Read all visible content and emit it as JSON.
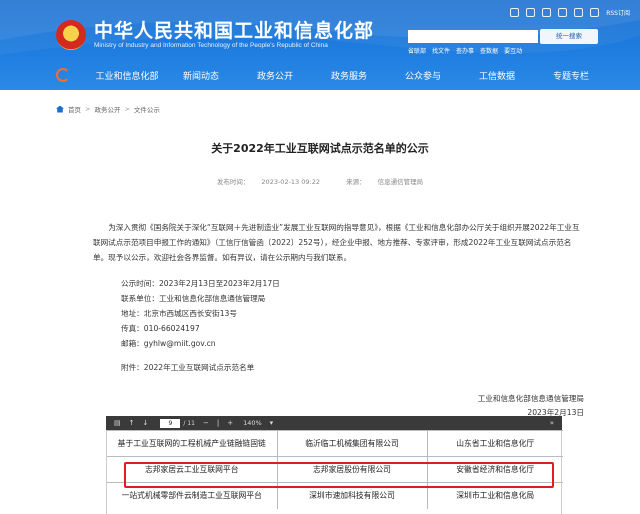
{
  "header": {
    "title": "中华人民共和国工业和信息化部",
    "subtitle": "Ministry of Industry and Information Technology of the People's Republic of China",
    "rss_label": "RSS订阅",
    "search_button": "统一搜索",
    "quick_links": [
      "省联部",
      "找文件",
      "查办事",
      "查数据",
      "要互动"
    ]
  },
  "nav": {
    "items": [
      "工业和信息化部",
      "新闻动态",
      "政务公开",
      "政务服务",
      "公众参与",
      "工信数据",
      "专题专栏"
    ]
  },
  "breadcrumb": [
    "首页",
    "政务公开",
    "文件公示"
  ],
  "article": {
    "title": "关于2022年工业互联网试点示范名单的公示",
    "publish_label": "发布时间：",
    "publish_time": "2023-02-13 09:22",
    "source_label": "来源：",
    "source": "信息通信管理局",
    "paragraph": "为深入贯彻《国务院关于深化“互联网＋先进制造业”发展工业互联网的指导意见》，根据《工业和信息化部办公厅关于组织开展2022年工业互联网试点示范项目申报工作的通知》（工信厅信管函〔2022〕252号），经企业申报、地方推荐、专家评审，形成2022年工业互联网试点示范名单。现予以公示，欢迎社会各界监督。如有异议，请在公示期内与我们联系。",
    "period": "公示时间：2023年2月13日至2023年2月17日",
    "unit": "联系单位：工业和信息化部信息通信管理局",
    "address": "地址：北京市西城区西长安街13号",
    "fax": "传真：010-66024197",
    "email": "邮箱：gyhlw@miit.gov.cn",
    "attachment": "附件：2022年工业互联网试点示范名单",
    "signer": "工业和信息化部信息通信管理局",
    "sign_date": "2023年2月13日"
  },
  "pdf": {
    "page_current": "9",
    "page_total": "/ 11",
    "zoom": "140%",
    "rows": [
      [
        "基于工业互联网的工程机械产业链融链固链",
        "临沂临工机械集团有限公司",
        "山东省工业和信息化厅"
      ],
      [
        "志邦家居云工业互联网平台",
        "志邦家居股份有限公司",
        "安徽省经济和信息化厅"
      ],
      [
        "一站式机械零部件云制造工业互联网平台",
        "深圳市速加科技有限公司",
        "深圳市工业和信息化局"
      ]
    ]
  },
  "colors": {
    "header_blue": "#1f7ee0",
    "highlight_red": "#e21d1d",
    "accent_orange": "#ff6a2a"
  }
}
